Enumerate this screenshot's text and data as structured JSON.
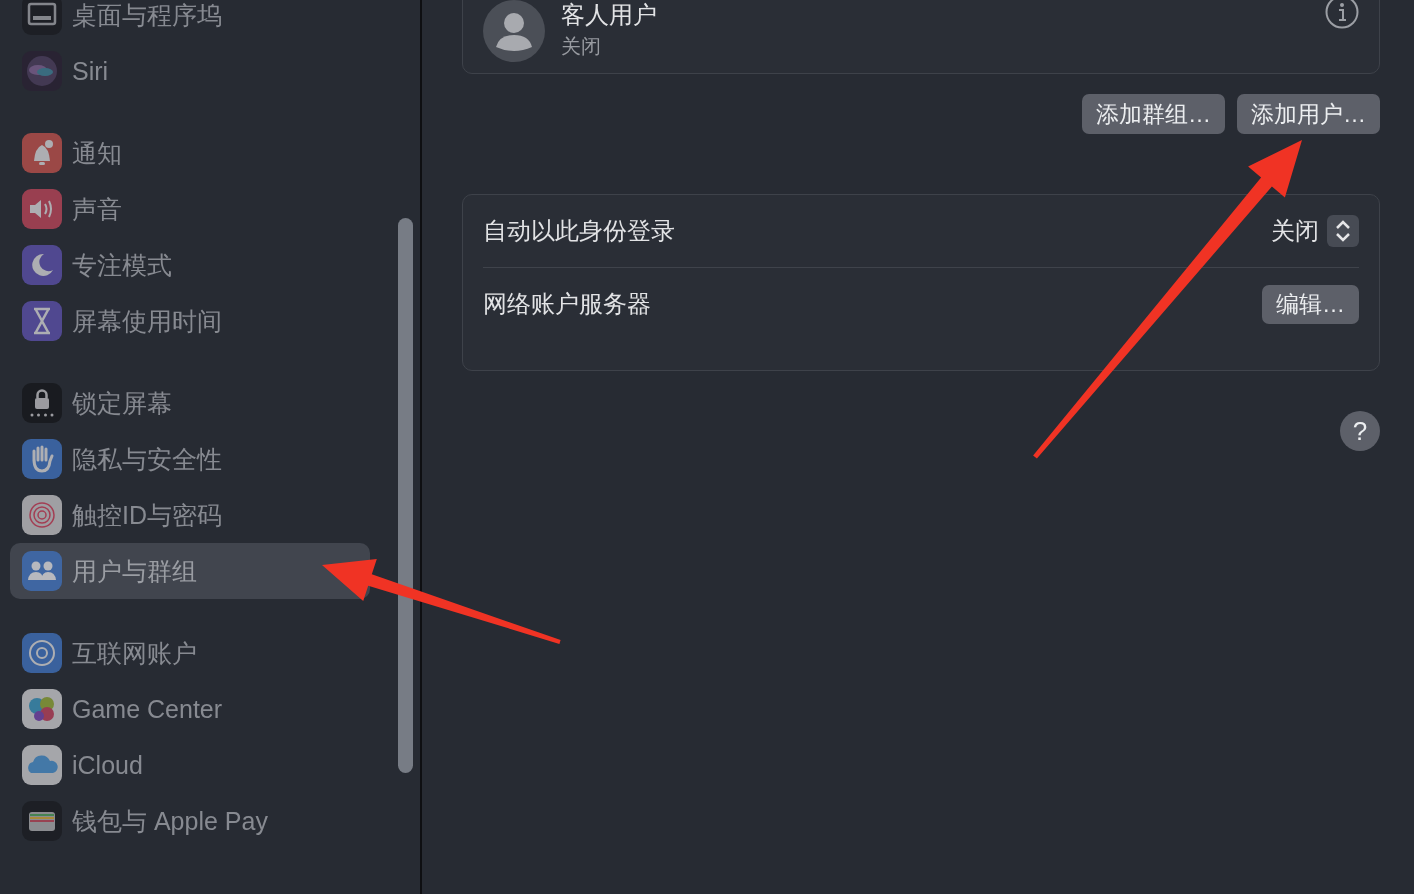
{
  "sidebar": {
    "groups": [
      {
        "items": [
          {
            "label": "桌面与程序坞",
            "kind": "dock",
            "selected": false
          },
          {
            "label": "Siri",
            "kind": "siri",
            "selected": false
          }
        ]
      },
      {
        "items": [
          {
            "label": "通知",
            "kind": "notifications",
            "selected": false
          },
          {
            "label": "声音",
            "kind": "sound",
            "selected": false
          },
          {
            "label": "专注模式",
            "kind": "focus",
            "selected": false
          },
          {
            "label": "屏幕使用时间",
            "kind": "screentime",
            "selected": false
          }
        ]
      },
      {
        "items": [
          {
            "label": "锁定屏幕",
            "kind": "lock",
            "selected": false
          },
          {
            "label": "隐私与安全性",
            "kind": "privacy",
            "selected": false
          },
          {
            "label": "触控ID与密码",
            "kind": "touchid",
            "selected": false
          },
          {
            "label": "用户与群组",
            "kind": "users",
            "selected": true
          }
        ]
      },
      {
        "items": [
          {
            "label": "互联网账户",
            "kind": "internet",
            "selected": false
          },
          {
            "label": "Game Center",
            "kind": "gamecenter",
            "selected": false
          },
          {
            "label": "iCloud",
            "kind": "icloud",
            "selected": false
          },
          {
            "label": "钱包与 Apple Pay",
            "kind": "wallet",
            "selected": false
          }
        ]
      }
    ]
  },
  "guest_user": {
    "name": "客人用户",
    "status": "关闭"
  },
  "buttons": [
    "添加群组…",
    "添加用户…"
  ],
  "settings": [
    {
      "kind": "popup",
      "label": "自动以此身份登录",
      "value": "关闭"
    },
    {
      "kind": "button",
      "label": "网络账户服务器",
      "button": "编辑…"
    }
  ],
  "help": "?"
}
